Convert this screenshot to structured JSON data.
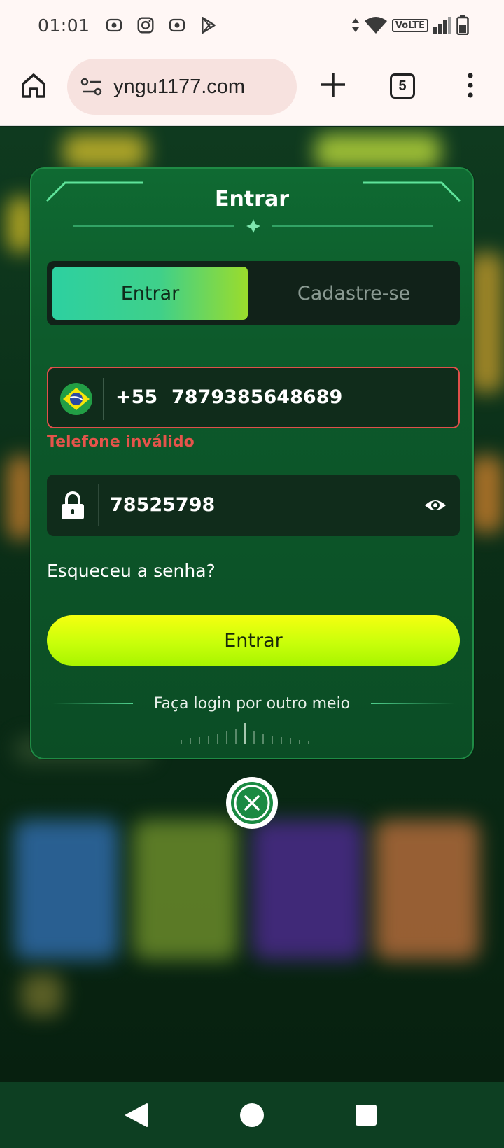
{
  "status_bar": {
    "time": "01:01",
    "volte": "VoLTE"
  },
  "browser": {
    "url": "yngu1177.com",
    "tab_count": "5"
  },
  "modal": {
    "title": "Entrar",
    "tabs": [
      {
        "label": "Entrar",
        "active": true
      },
      {
        "label": "Cadastre-se",
        "active": false
      }
    ],
    "phone": {
      "country_code": "+55",
      "value": "7879385648689",
      "error": "Telefone inválido"
    },
    "password": {
      "value": "78525798"
    },
    "forgot_label": "Esqueceu a senha?",
    "submit_label": "Entrar",
    "other_login_label": "Faça login por outro meio"
  },
  "colors": {
    "accent_green": "#2dd0a0",
    "submit_yellow": "#f5ff10",
    "error_red": "#e5544b",
    "modal_bg": "#0f6a32"
  }
}
